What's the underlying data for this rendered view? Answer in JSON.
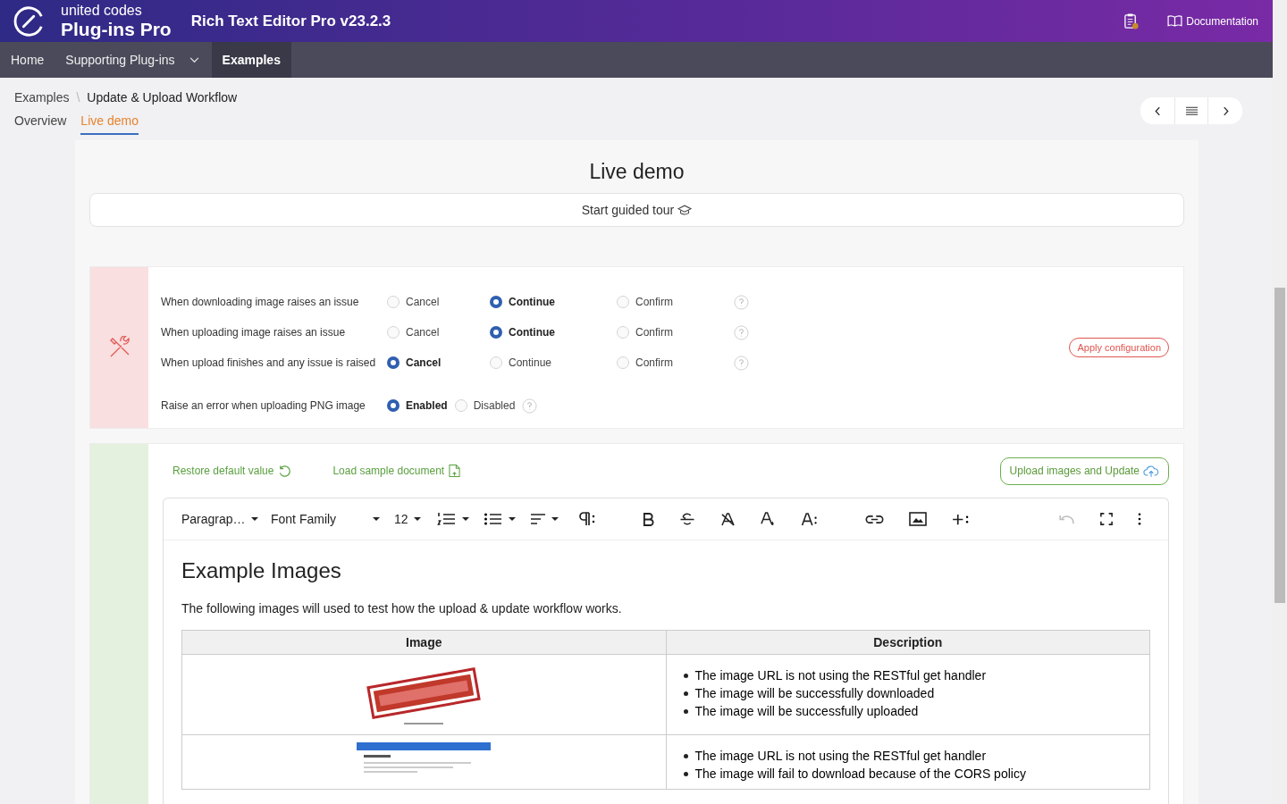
{
  "header": {
    "logo_top": "united codes",
    "logo_bottom": "Plug-ins Pro",
    "title": "Rich Text Editor Pro v23.2.3",
    "doc_link": "Documentation"
  },
  "nav": [
    {
      "label": "Home",
      "selected": false,
      "dropdown": false
    },
    {
      "label": "Supporting Plug-ins",
      "selected": false,
      "dropdown": true
    },
    {
      "label": "Examples",
      "selected": true,
      "dropdown": false
    }
  ],
  "breadcrumb": [
    "Examples",
    "Update & Upload Workflow"
  ],
  "breadcrumb_separator": "\\",
  "tabs": [
    {
      "label": "Overview",
      "selected": false
    },
    {
      "label": "Live demo",
      "selected": true
    }
  ],
  "page_title": "Live demo",
  "tour_button": "Start guided tour",
  "config": {
    "rows": [
      {
        "kind": "grid",
        "label": "When downloading image raises an issue",
        "options": [
          {
            "label": "Cancel",
            "selected": false
          },
          {
            "label": "Continue",
            "selected": true
          },
          {
            "label": "Confirm",
            "selected": false
          }
        ]
      },
      {
        "kind": "grid",
        "label": "When uploading image raises an issue",
        "options": [
          {
            "label": "Cancel",
            "selected": false
          },
          {
            "label": "Continue",
            "selected": true
          },
          {
            "label": "Confirm",
            "selected": false
          }
        ]
      },
      {
        "kind": "grid",
        "label": "When upload finishes and any issue is raised",
        "options": [
          {
            "label": "Cancel",
            "selected": true
          },
          {
            "label": "Continue",
            "selected": false
          },
          {
            "label": "Confirm",
            "selected": false
          }
        ]
      },
      {
        "kind": "inline",
        "label": "Raise an error when uploading PNG image",
        "options": [
          {
            "label": "Enabled",
            "selected": true
          },
          {
            "label": "Disabled",
            "selected": false
          }
        ]
      }
    ],
    "apply_button": "Apply configuration"
  },
  "editor_panel": {
    "restore_link": "Restore default value",
    "load_link": "Load sample document",
    "upload_button": "Upload images and Update",
    "toolbar": {
      "block_format": "Paragrap…",
      "font_family": "Font Family",
      "font_size": "12"
    },
    "heading": "Example Images",
    "paragraph": "The following images will used to test how the upload & update workflow works.",
    "table": {
      "columns": [
        "Image",
        "Description"
      ],
      "rows": [
        {
          "image": {
            "kind": "picture"
          },
          "items": [
            "The image URL is not using the RESTful get handler",
            "The image will be successfully downloaded",
            "The image will be successfully uploaded"
          ]
        },
        {
          "image": {
            "kind": "picture"
          },
          "items": [
            "The image URL is not using the RESTful get handler",
            "The image will fail to download because of the CORS policy"
          ]
        }
      ]
    }
  }
}
